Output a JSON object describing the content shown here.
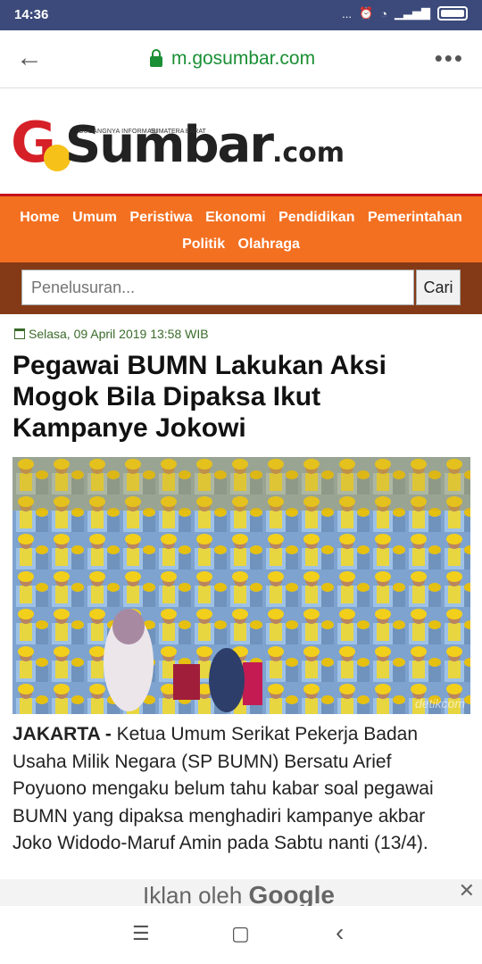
{
  "status": {
    "time": "14:36",
    "dots": "...",
    "alarm": "⏰",
    "wifi": "◔",
    "signal": "▁▃▅▇"
  },
  "browser": {
    "url": "m.gosumbar.com",
    "back_icon": "←",
    "menu_icon": "•••"
  },
  "logo": {
    "g": "G",
    "sumbar": "Sumbar",
    "com": ".com",
    "tagline_left": "GUDANGNYA INFORMASI",
    "tagline_right": "SUMATERA BARAT"
  },
  "nav": {
    "items": [
      "Home",
      "Umum",
      "Peristiwa",
      "Ekonomi",
      "Pendidikan",
      "Pemerintahan",
      "Politik",
      "Olahraga"
    ]
  },
  "search": {
    "placeholder": "Penelusuran...",
    "button": "Cari"
  },
  "article": {
    "date": "Selasa, 09 April 2019 13:58 WIB",
    "title": "Pegawai BUMN Lakukan Aksi Mogok Bila Dipaksa Ikut Kampanye Jokowi",
    "image_watermark": "detikcom",
    "location": "JAKARTA -",
    "body": " Ketua Umum Serikat Pekerja Badan Usaha Milik Negara (SP BUMN) Bersatu Arief Poyuono mengaku belum tahu kabar soal pegawai BUMN yang dipaksa menghadiri kampanye akbar Joko Widodo-Maruf Amin pada Sabtu nanti (13/4)."
  },
  "ad": {
    "label": "Iklan oleh",
    "brand": "Google",
    "close": "✕"
  },
  "system_nav": {
    "recent": "☰",
    "home": "▢",
    "back": "‹"
  },
  "colors": {
    "nav_orange": "#f37021",
    "search_brown": "#843a16",
    "url_green": "#1a8f35",
    "logo_red": "#d62027",
    "logo_yellow": "#f6c21a"
  }
}
